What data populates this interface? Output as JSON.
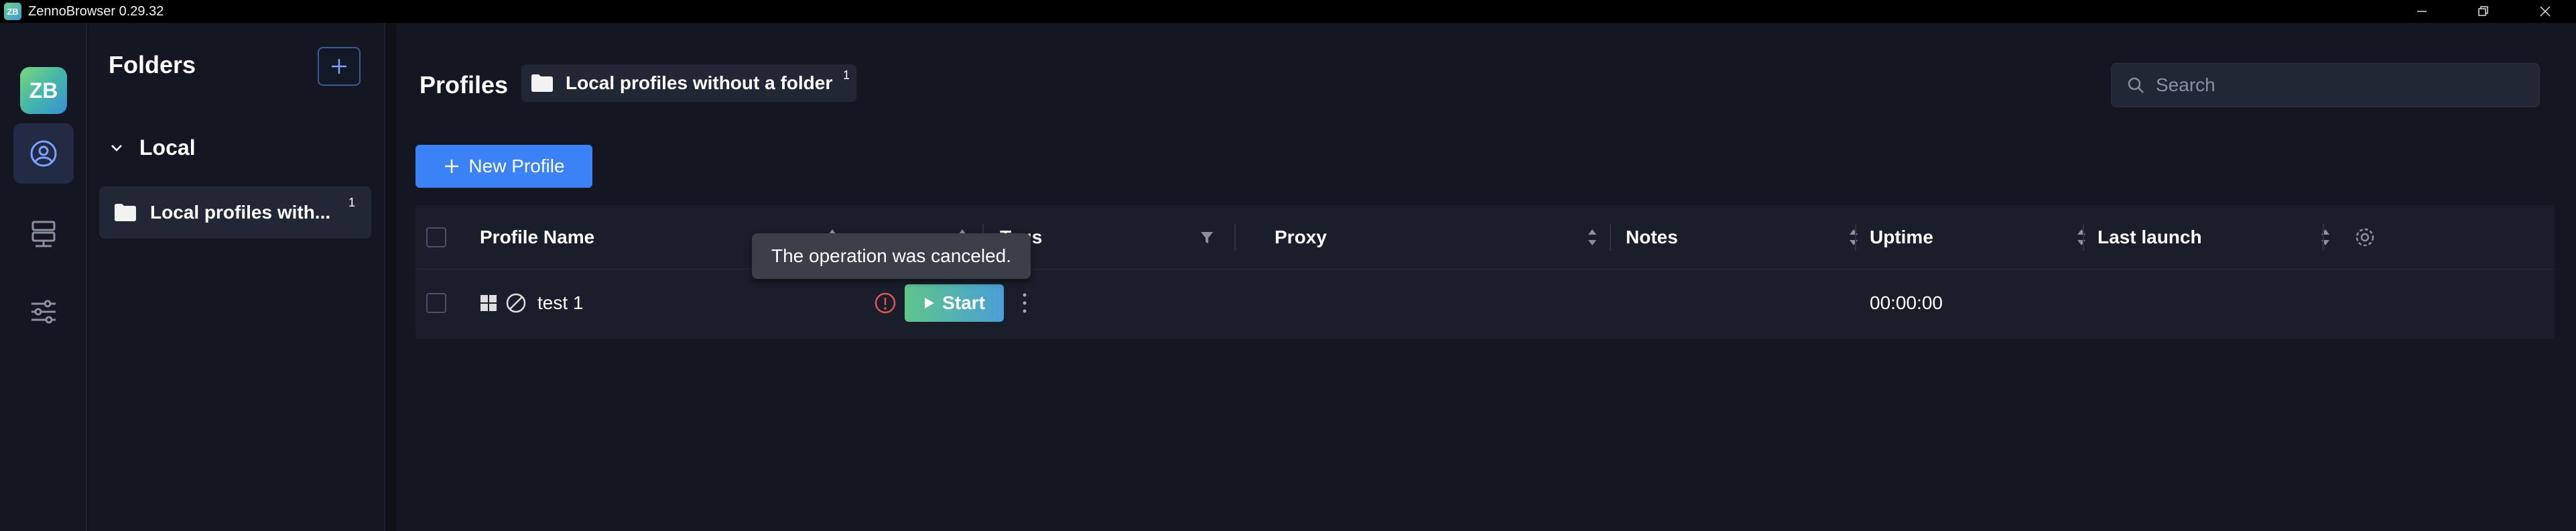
{
  "window": {
    "title": "ZennoBrowser 0.29.32",
    "logo_text": "ZB",
    "controls": [
      "minimize-icon",
      "restore-icon",
      "close-icon"
    ]
  },
  "rail": {
    "logo_text": "ZB",
    "items": [
      {
        "icon": "user-icon",
        "active": true
      },
      {
        "icon": "server-icon",
        "active": false
      },
      {
        "icon": "sliders-icon",
        "active": false
      }
    ]
  },
  "folders": {
    "title": "Folders",
    "add_icon": "plus-icon",
    "group_label": "Local",
    "items": [
      {
        "label": "Local profiles with...",
        "count": "1"
      }
    ]
  },
  "main": {
    "title": "Profiles",
    "current_folder": {
      "label": "Local profiles without a folder",
      "count": "1"
    },
    "search_placeholder": "Search",
    "new_profile_label": "New Profile"
  },
  "table": {
    "columns": [
      "Profile Name",
      "Tags",
      "Proxy",
      "Notes",
      "Uptime",
      "Last launch"
    ],
    "rows": [
      {
        "name": "test 1",
        "status": "error",
        "action": "Start",
        "uptime": "00:00:00"
      }
    ]
  },
  "tooltip": {
    "text": "The operation was canceled."
  },
  "colors": {
    "background": "#141722",
    "accent": "#3b82f6",
    "start_gradient_from": "#5ec68a",
    "start_gradient_to": "#4a9ed8",
    "error": "#e05454"
  }
}
